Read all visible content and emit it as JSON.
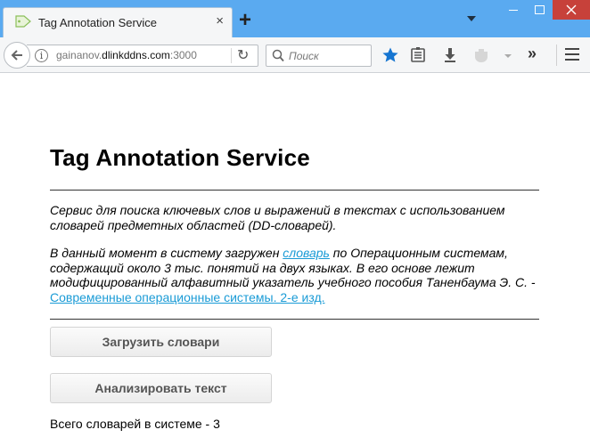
{
  "browser": {
    "tab_title": "Tag Annotation Service",
    "tab_close": "×",
    "new_tab": "+",
    "url_prefix": "gainanov.",
    "url_domain": "dlinkddns.com",
    "url_suffix": ":3000",
    "search_placeholder": "Поиск",
    "info_glyph": "i",
    "reload_glyph": "↻",
    "overflow_glyph": "»",
    "accent_color": "#5aaaf0",
    "icons": [
      "tag-icon",
      "back-arrow-icon",
      "info-icon",
      "reload-icon",
      "search-icon",
      "star-icon",
      "reading-list-icon",
      "download-icon",
      "pocket-icon",
      "overflow-icon",
      "hamburger-menu-icon"
    ]
  },
  "page": {
    "title": "Tag Annotation Service",
    "intro": "Сервис для поиска ключевых слов и выражений в текстах с использованием словарей предметных областей (DD-словарей).",
    "loaded_prefix": "В данный момент в систему загружен ",
    "loaded_link": "словарь",
    "loaded_middle": " по Операционным системам, содержащий около 3 тыс. понятий на двух языках. В его основе лежит модифицированный алфавитный указатель учебного пособия Таненбаума Э. С. - ",
    "book_link": "Современные операционные системы. 2-е изд.",
    "link_color": "#1a9bd6",
    "load_button": "Загрузить словари",
    "analyze_button": "Анализировать текст",
    "total_text": "Всего словарей в системе - 3"
  }
}
